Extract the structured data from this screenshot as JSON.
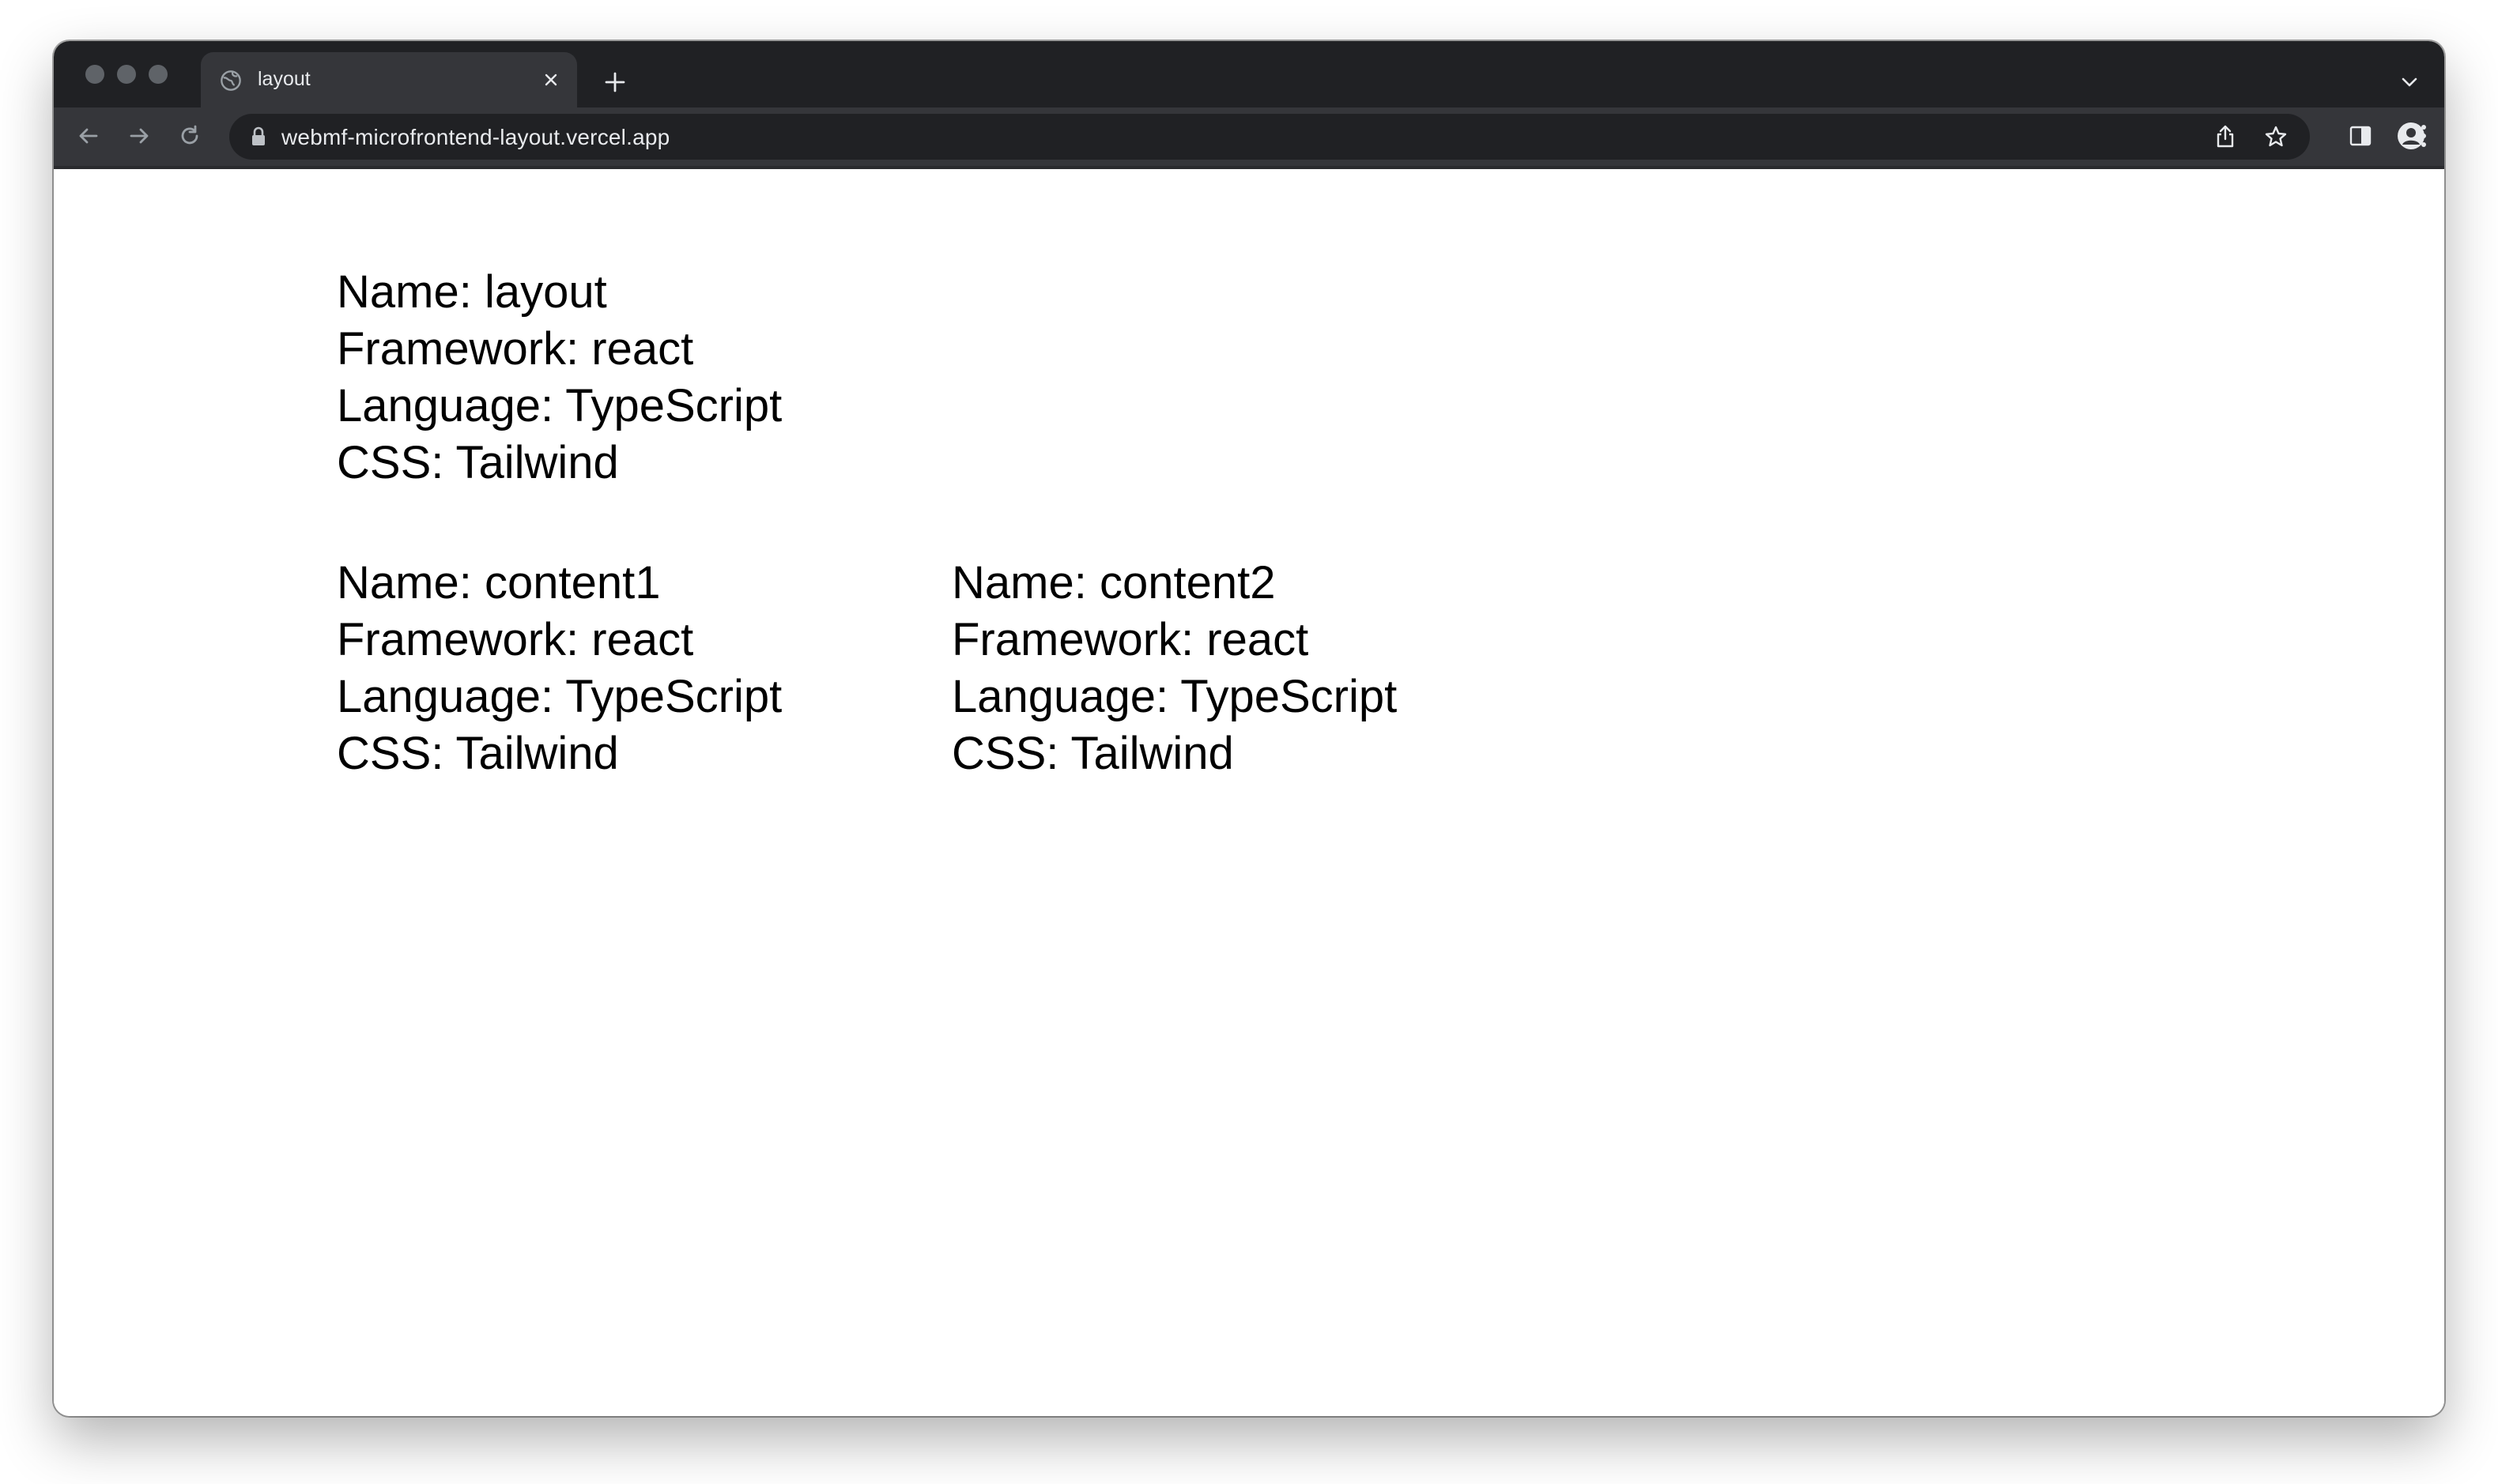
{
  "browser": {
    "tab": {
      "title": "layout"
    },
    "address_bar": {
      "url": "webmf-microfrontend-layout.vercel.app"
    }
  },
  "page": {
    "layout": {
      "name": "Name: layout",
      "framework": "Framework: react",
      "language": "Language: TypeScript",
      "css": "CSS: Tailwind"
    },
    "content1": {
      "name": "Name: content1",
      "framework": "Framework: react",
      "language": "Language: TypeScript",
      "css": "CSS: Tailwind"
    },
    "content2": {
      "name": "Name: content2",
      "framework": "Framework: react",
      "language": "Language: TypeScript",
      "css": "CSS: Tailwind"
    }
  }
}
